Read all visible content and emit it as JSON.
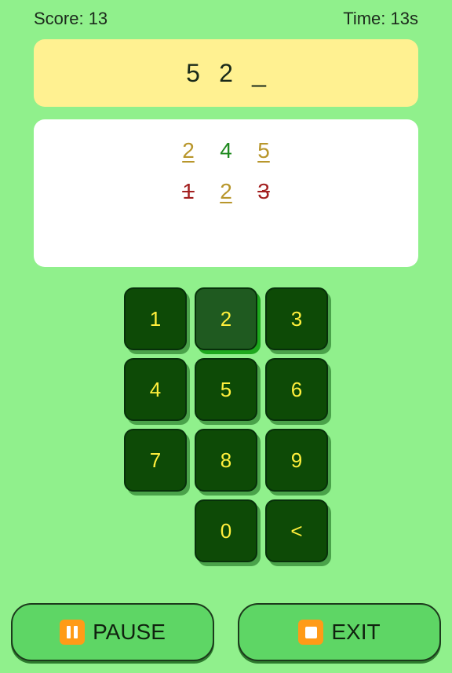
{
  "status": {
    "score_text": "Score: 13",
    "time_text": "Time: 13s"
  },
  "guess": {
    "slots": [
      "5",
      "2",
      "_"
    ]
  },
  "history": [
    {
      "digits": [
        {
          "value": "2",
          "state": "present"
        },
        {
          "value": "4",
          "state": "correct"
        },
        {
          "value": "5",
          "state": "present"
        }
      ]
    },
    {
      "digits": [
        {
          "value": "1",
          "state": "absent"
        },
        {
          "value": "2",
          "state": "present"
        },
        {
          "value": "3",
          "state": "absent"
        }
      ]
    }
  ],
  "keypad": {
    "keys": [
      "1",
      "2",
      "3",
      "4",
      "5",
      "6",
      "7",
      "8",
      "9",
      "0",
      "<"
    ],
    "active_key": "2"
  },
  "buttons": {
    "pause_label": "PAUSE",
    "exit_label": "EXIT"
  },
  "colors": {
    "background": "#90f08c",
    "guess_box": "#fff191",
    "key_bg": "#0d4a06",
    "key_text": "#ffef3c",
    "correct": "#1f8a1f",
    "present": "#b8962b",
    "absent": "#a32020",
    "button_bg": "#5ed665",
    "icon_bg": "#ff9b17"
  }
}
